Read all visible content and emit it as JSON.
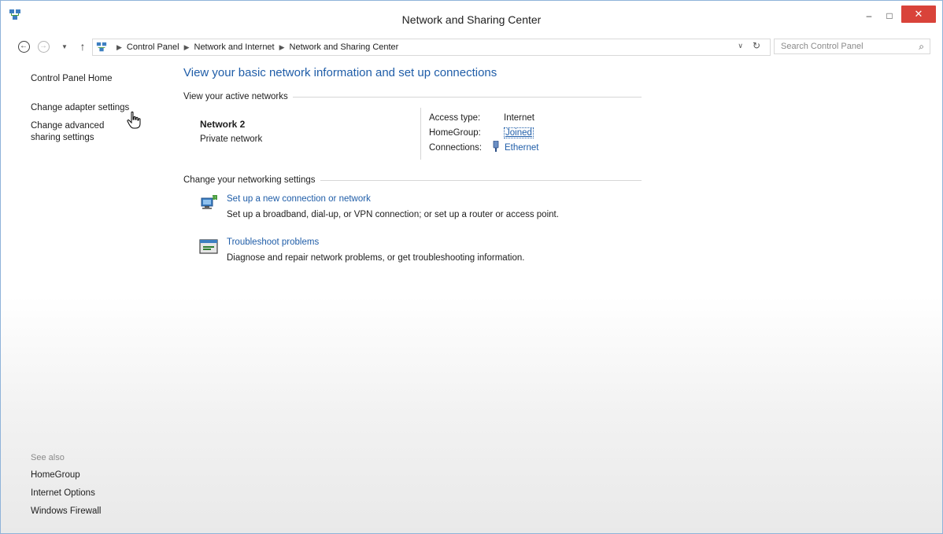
{
  "window": {
    "title": "Network and Sharing Center",
    "controls": {
      "minimize": "–",
      "maximize": "□",
      "close": "✕"
    }
  },
  "navigation": {
    "back_icon": "back-arrow-icon",
    "forward_icon": "forward-arrow-icon",
    "breadcrumb": [
      "Control Panel",
      "Network and Internet",
      "Network and Sharing Center"
    ],
    "search_placeholder": "Search Control Panel"
  },
  "sidebar": {
    "home": "Control Panel Home",
    "links": [
      "Change adapter settings",
      "Change advanced sharing settings"
    ],
    "see_also_title": "See also",
    "see_also": [
      "HomeGroup",
      "Internet Options",
      "Windows Firewall"
    ]
  },
  "main": {
    "title": "View your basic network information and set up connections",
    "active_networks_header": "View your active networks",
    "network": {
      "name": "Network  2",
      "type": "Private network",
      "access_type_label": "Access type:",
      "access_type_value": "Internet",
      "homegroup_label": "HomeGroup:",
      "homegroup_value": "Joined",
      "connections_label": "Connections:",
      "connections_value": "Ethernet"
    },
    "change_settings_header": "Change your networking settings",
    "tasks": [
      {
        "link": "Set up a new connection or network",
        "description": "Set up a broadband, dial-up, or VPN connection; or set up a router or access point.",
        "icon": "new-connection-icon"
      },
      {
        "link": "Troubleshoot problems",
        "description": "Diagnose and repair network problems, or get troubleshooting information.",
        "icon": "troubleshoot-icon"
      }
    ]
  },
  "colors": {
    "link": "#1f5da8",
    "close_button": "#d9433a",
    "window_border": "#8fb3d9"
  }
}
